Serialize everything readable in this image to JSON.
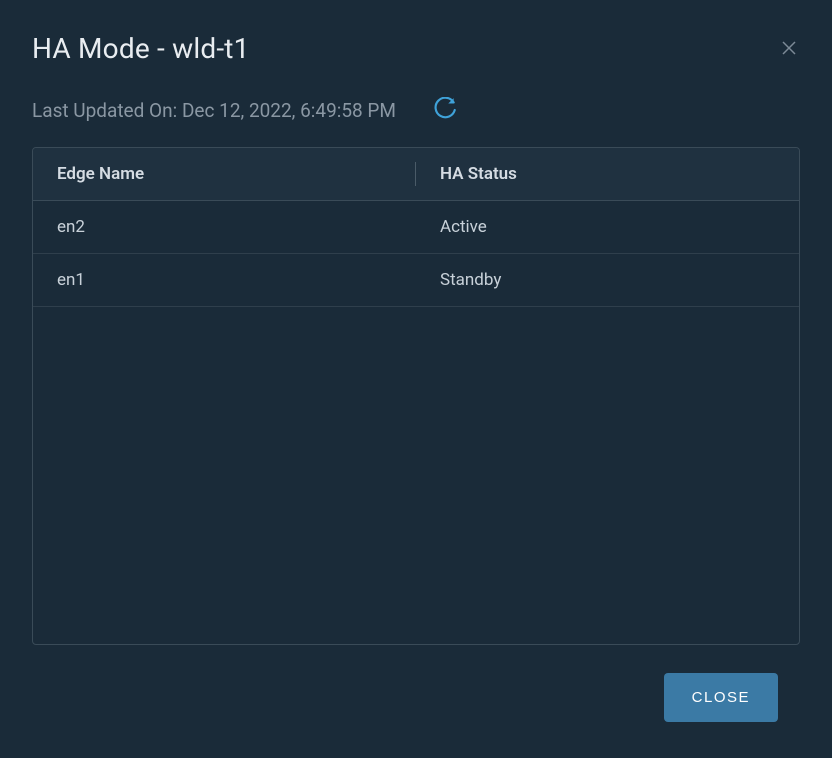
{
  "modal": {
    "title": "HA Mode - wld-t1",
    "status_label": "Last Updated On: Dec 12, 2022, 6:49:58 PM",
    "close_button": "CLOSE"
  },
  "table": {
    "columns": {
      "edge_name": "Edge Name",
      "ha_status": "HA Status"
    },
    "rows": [
      {
        "edge_name": "en2",
        "ha_status": "Active"
      },
      {
        "edge_name": "en1",
        "ha_status": "Standby"
      }
    ]
  }
}
